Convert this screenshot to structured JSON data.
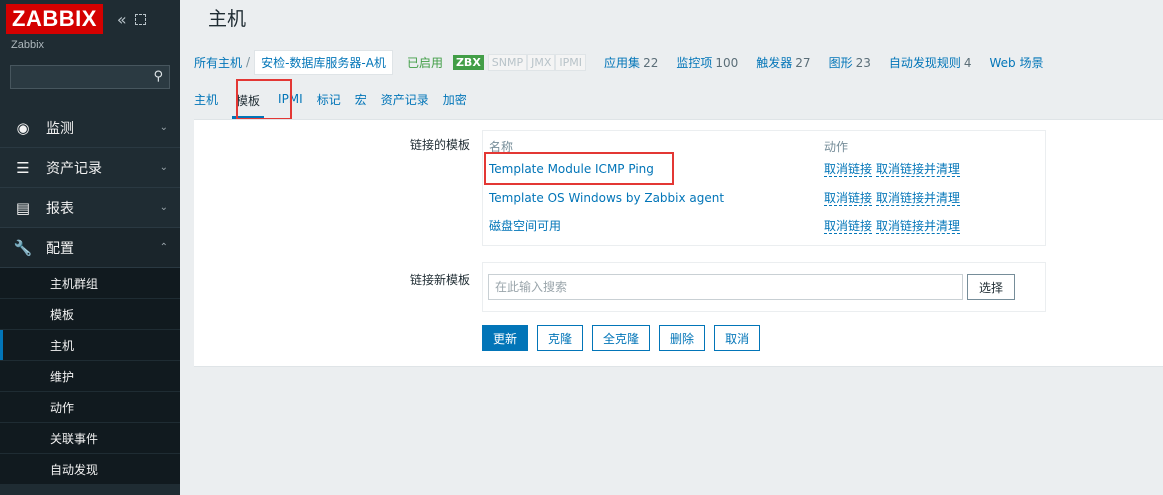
{
  "sidebar": {
    "logo": "ZABBIX",
    "collapse_icon": "«",
    "server_name": "Zabbix",
    "search_placeholder": "",
    "menu": [
      {
        "label": "监测",
        "icon": "eye-icon"
      },
      {
        "label": "资产记录",
        "icon": "list-icon"
      },
      {
        "label": "报表",
        "icon": "bar-chart-icon"
      },
      {
        "label": "配置",
        "icon": "wrench-icon"
      }
    ],
    "submenu": [
      "主机群组",
      "模板",
      "主机",
      "维护",
      "动作",
      "关联事件",
      "自动发现"
    ]
  },
  "page": {
    "title": "主机"
  },
  "host_nav": {
    "all_hosts": "所有主机",
    "separator": "/",
    "current_host": "安检-数据库服务器-A机",
    "status": "已启用",
    "tags": [
      "ZBX",
      "SNMP",
      "JMX",
      "IPMI"
    ],
    "links": [
      {
        "label": "应用集",
        "count": "22"
      },
      {
        "label": "监控项",
        "count": "100"
      },
      {
        "label": "触发器",
        "count": "27"
      },
      {
        "label": "图形",
        "count": "23"
      },
      {
        "label": "自动发现规则",
        "count": "4"
      },
      {
        "label": "Web 场景",
        "count": ""
      }
    ]
  },
  "tabs": [
    "主机",
    "模板",
    "IPMI",
    "标记",
    "宏",
    "资产记录",
    "加密"
  ],
  "linked_templates": {
    "label": "链接的模板",
    "col_name": "名称",
    "col_action": "动作",
    "rows": [
      {
        "name": "Template Module ICMP Ping",
        "unlink": "取消链接",
        "unlink_clear": "取消链接并清理"
      },
      {
        "name": "Template OS Windows by Zabbix agent",
        "unlink": "取消链接",
        "unlink_clear": "取消链接并清理"
      },
      {
        "name": "磁盘空间可用",
        "unlink": "取消链接",
        "unlink_clear": "取消链接并清理"
      }
    ]
  },
  "link_new": {
    "label": "链接新模板",
    "placeholder": "在此输入搜索",
    "select": "选择"
  },
  "buttons": {
    "update": "更新",
    "clone": "克隆",
    "full_clone": "全克隆",
    "delete": "删除",
    "cancel": "取消"
  },
  "colors": {
    "accent": "#0275b8",
    "enabled": "#429e47",
    "logo": "#d40000",
    "highlight": "#e33734"
  }
}
